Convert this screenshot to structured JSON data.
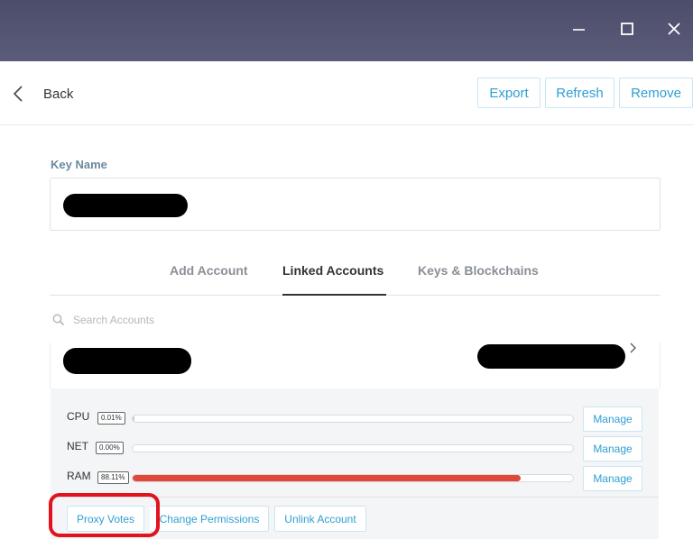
{
  "window": {
    "controls": {
      "minimize_icon": "minimize-icon",
      "maximize_icon": "maximize-icon",
      "close_icon": "close-icon"
    }
  },
  "header": {
    "back_label": "Back",
    "buttons": {
      "export": "Export",
      "refresh": "Refresh",
      "remove": "Remove"
    },
    "accent_color": "#2e9fd4"
  },
  "key": {
    "label": "Key Name",
    "value_redacted": true
  },
  "tabs": [
    {
      "label": "Add Account",
      "active": false
    },
    {
      "label": "Linked Accounts",
      "active": true
    },
    {
      "label": "Keys & Blockchains",
      "active": false
    }
  ],
  "search": {
    "placeholder": "Search Accounts",
    "value": ""
  },
  "account": {
    "name_redacted": true,
    "balance_redacted": true,
    "resources": [
      {
        "name": "CPU",
        "percent_label": "0.01%",
        "fill_fraction": 0.0001,
        "fill_color": "#c8ccd2",
        "manage_label": "Manage"
      },
      {
        "name": "NET",
        "percent_label": "0.00%",
        "fill_fraction": 0.0,
        "fill_color": "#c8ccd2",
        "manage_label": "Manage"
      },
      {
        "name": "RAM",
        "percent_label": "88.11%",
        "fill_fraction": 0.8811,
        "fill_color": "#e0483a",
        "manage_label": "Manage"
      }
    ],
    "actions": {
      "proxy_votes": "Proxy Votes",
      "change_permissions": "Change Permissions",
      "unlink_account": "Unlink Account"
    }
  },
  "annotation": {
    "highlight_color": "#e3131d",
    "highlighted_action": "proxy_votes"
  }
}
